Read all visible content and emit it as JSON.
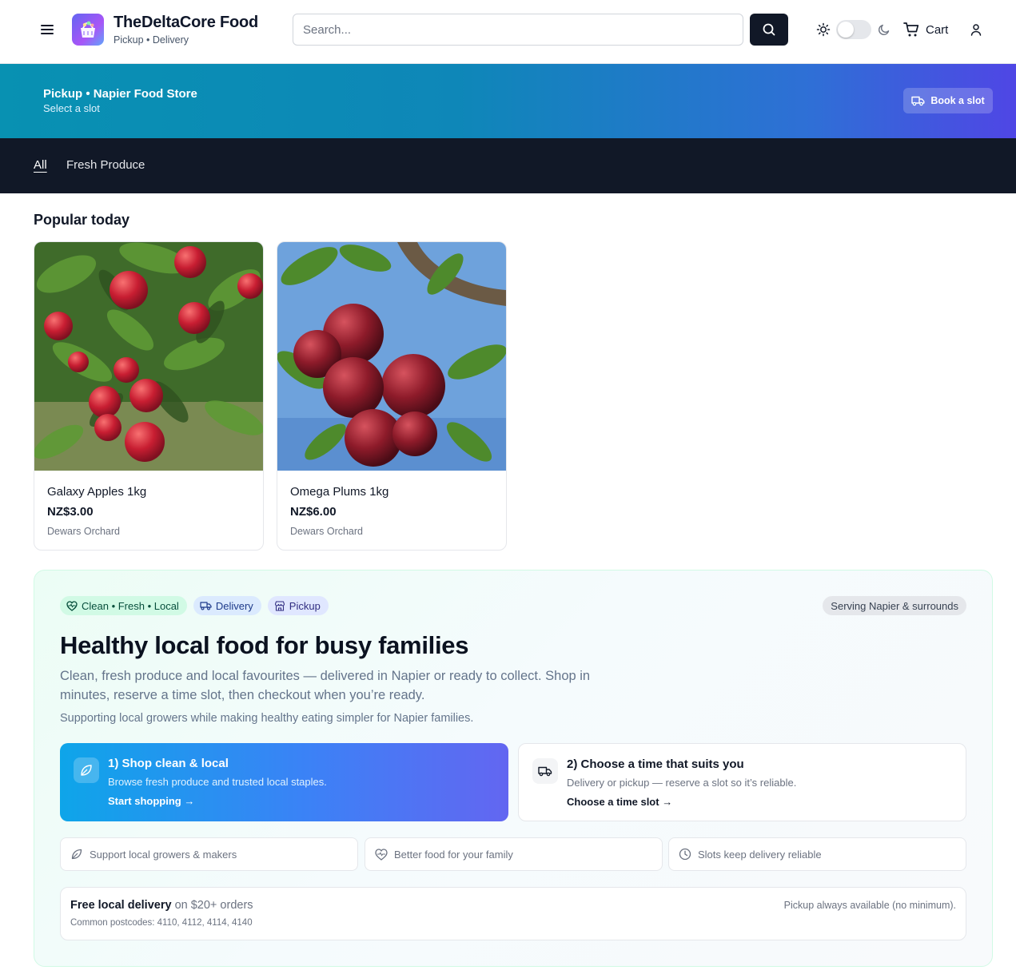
{
  "header": {
    "brand_name": "TheDeltaCore Food",
    "brand_sub": "Pickup • Delivery",
    "search_placeholder": "Search...",
    "cart_label": "Cart",
    "icons": [
      "menu-icon",
      "basket-logo-icon",
      "search-icon",
      "sun-icon",
      "moon-icon",
      "cart-icon",
      "user-icon"
    ]
  },
  "banner": {
    "title": "Pickup • Napier Food Store",
    "subtitle": "Select a slot",
    "button_label": "Book a slot"
  },
  "categories": {
    "items": [
      "All",
      "Fresh Produce"
    ],
    "active": "All"
  },
  "popular": {
    "title": "Popular today",
    "products": [
      {
        "name": "Galaxy Apples 1kg",
        "price": "NZ$3.00",
        "vendor": "Dewars Orchard"
      },
      {
        "name": "Omega Plums 1kg",
        "price": "NZ$6.00",
        "vendor": "Dewars Orchard"
      }
    ]
  },
  "hero": {
    "pills": [
      "Clean • Fresh • Local",
      "Delivery",
      "Pickup"
    ],
    "serving": "Serving Napier & surrounds",
    "title": "Healthy local food for busy families",
    "paragraph": "Clean, fresh produce and local favourites — delivered in Napier or ready to collect. Shop in minutes, reserve a time slot, then checkout when you’re ready.",
    "paragraph2": "Supporting local growers while making healthy eating simpler for Napier families.",
    "steps": [
      {
        "title": "1) Shop clean & local",
        "desc": "Browse fresh produce and trusted local staples.",
        "link": "Start shopping →"
      },
      {
        "title": "2) Choose a time that suits you",
        "desc": "Delivery or pickup — reserve a slot so it’s reliable.",
        "link": "Choose a time slot →"
      }
    ],
    "features": [
      "Support local growers & makers",
      "Better food for your family",
      "Slots keep delivery reliable"
    ],
    "delivery": {
      "strong": "Free local delivery",
      "rest": "on $20+ orders",
      "postcodes": "Common postcodes: 4110, 4112, 4114, 4140",
      "pickup_note": "Pickup always available (no minimum)."
    }
  },
  "colors": {
    "dark": "#111827",
    "banner_from": "#0891b2",
    "banner_to": "#4f46e5",
    "step_from": "#0ea5e9",
    "step_to": "#6366f1",
    "hero_border": "#d1fae5"
  }
}
